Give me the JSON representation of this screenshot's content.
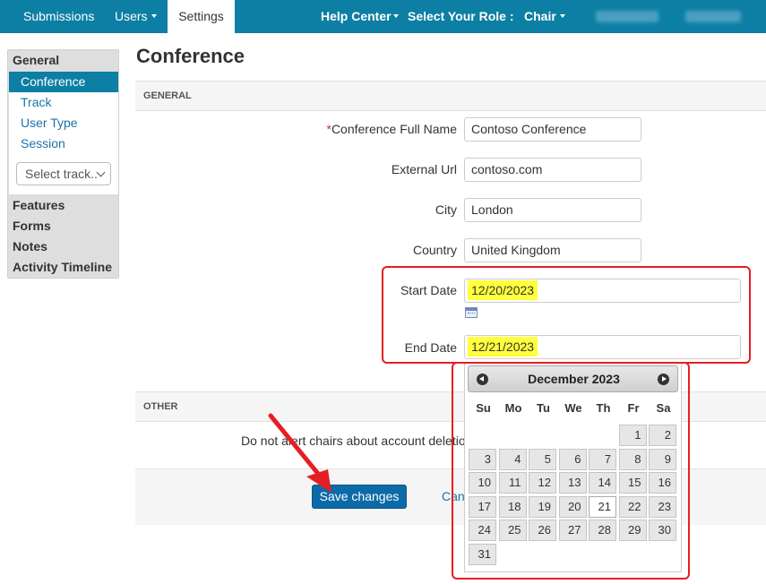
{
  "topbar": {
    "submissions": "Submissions",
    "users": "Users",
    "settings": "Settings",
    "help_center": "Help Center",
    "select_role": "Select Your Role :",
    "role_value": "Chair"
  },
  "sidebar": {
    "general": "General",
    "items": [
      "Conference",
      "Track",
      "User Type",
      "Session"
    ],
    "track_select": "Select track..",
    "features": "Features",
    "forms": "Forms",
    "notes": "Notes",
    "activity_timeline": "Activity Timeline"
  },
  "main": {
    "title": "Conference",
    "general_section": "GENERAL",
    "other_section": "OTHER",
    "fields": {
      "full_name": {
        "label": "Conference Full Name",
        "required_mark": "*",
        "value": "Contoso Conference"
      },
      "external_url": {
        "label": "External Url",
        "value": "contoso.com"
      },
      "city": {
        "label": "City",
        "value": "London"
      },
      "country": {
        "label": "Country",
        "value": "United Kingdom"
      },
      "start_date": {
        "label": "Start Date",
        "value": "12/20/2023"
      },
      "end_date": {
        "label": "End Date",
        "value": "12/21/2023"
      }
    },
    "other_option": "Do not alert chairs about account deletion",
    "save_button": "Save changes",
    "cancel_link": "Cancel"
  },
  "datepicker": {
    "month_label": "December 2023",
    "weekdays": [
      "Su",
      "Mo",
      "Tu",
      "We",
      "Th",
      "Fr",
      "Sa"
    ],
    "first_weekday_index": 5,
    "days_in_month": 31,
    "today": 21
  },
  "colors": {
    "topbar": "#0d7fa4",
    "highlight": "#ffff3c",
    "annotation_red": "#e51e25",
    "primary_button": "#0d6aa8"
  }
}
